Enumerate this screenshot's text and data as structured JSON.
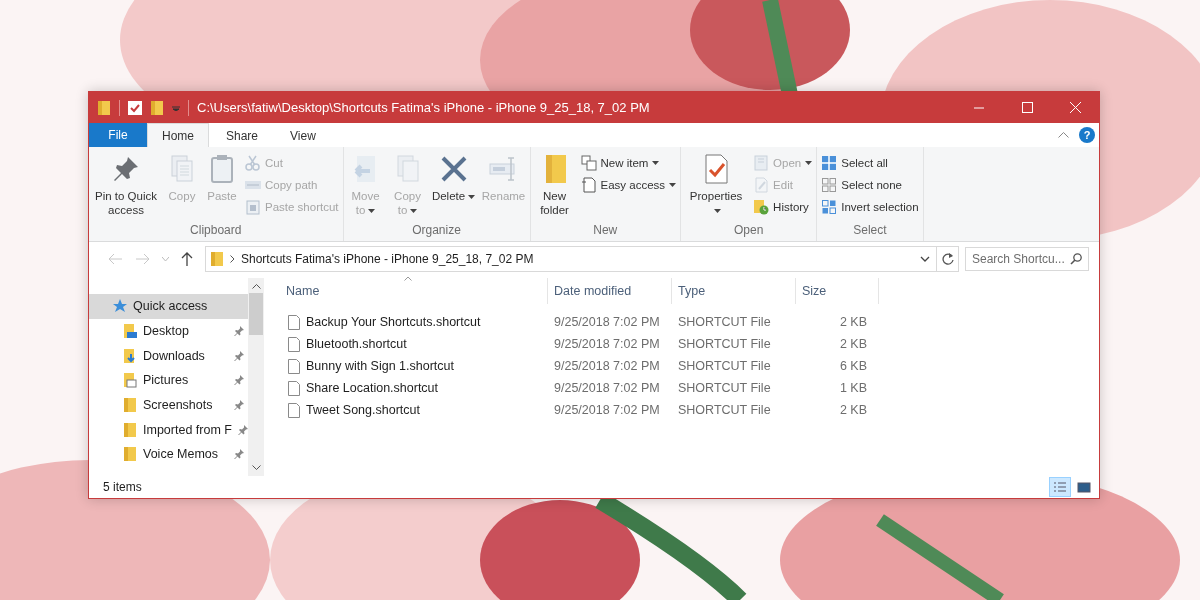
{
  "window": {
    "title": "C:\\Users\\fatiw\\Desktop\\Shortcuts Fatima's iPhone - iPhone 9_25_18, 7_02 PM"
  },
  "tabs": [
    {
      "label": "File",
      "kind": "file",
      "selected": false
    },
    {
      "label": "Home",
      "kind": "tab",
      "selected": true
    },
    {
      "label": "Share",
      "kind": "tab",
      "selected": false
    },
    {
      "label": "View",
      "kind": "tab",
      "selected": false
    }
  ],
  "help_button": "?",
  "ribbon": {
    "groups": [
      {
        "label": "Clipboard",
        "items": [
          {
            "label": "Pin to Quick access",
            "kind": "large",
            "disabled": false,
            "dropdown": false
          },
          {
            "label": "Copy",
            "kind": "large",
            "disabled": true,
            "dropdown": false
          },
          {
            "label": "Paste",
            "kind": "large",
            "disabled": true,
            "dropdown": false
          },
          {
            "label": "Cut",
            "kind": "small",
            "disabled": true,
            "dropdown": false
          },
          {
            "label": "Copy path",
            "kind": "small",
            "disabled": true,
            "dropdown": false
          },
          {
            "label": "Paste shortcut",
            "kind": "small",
            "disabled": true,
            "dropdown": false
          }
        ]
      },
      {
        "label": "Organize",
        "items": [
          {
            "label": "Move to",
            "kind": "large",
            "disabled": true,
            "dropdown": true
          },
          {
            "label": "Copy to",
            "kind": "large",
            "disabled": true,
            "dropdown": true
          },
          {
            "label": "Delete",
            "kind": "large",
            "disabled": false,
            "dropdown": true
          },
          {
            "label": "Rename",
            "kind": "large",
            "disabled": true,
            "dropdown": false
          }
        ]
      },
      {
        "label": "New",
        "items": [
          {
            "label": "New folder",
            "kind": "large",
            "disabled": false,
            "dropdown": false
          },
          {
            "label": "New item",
            "kind": "small",
            "disabled": false,
            "dropdown": true
          },
          {
            "label": "Easy access",
            "kind": "small",
            "disabled": false,
            "dropdown": true
          }
        ]
      },
      {
        "label": "Open",
        "items": [
          {
            "label": "Properties",
            "kind": "large",
            "disabled": false,
            "dropdown": true
          },
          {
            "label": "Open",
            "kind": "small",
            "disabled": true,
            "dropdown": true
          },
          {
            "label": "Edit",
            "kind": "small",
            "disabled": true,
            "dropdown": false
          },
          {
            "label": "History",
            "kind": "small",
            "disabled": false,
            "dropdown": false
          }
        ]
      },
      {
        "label": "Select",
        "items": [
          {
            "label": "Select all",
            "kind": "small",
            "disabled": false,
            "dropdown": false
          },
          {
            "label": "Select none",
            "kind": "small",
            "disabled": false,
            "dropdown": false
          },
          {
            "label": "Invert selection",
            "kind": "small",
            "disabled": false,
            "dropdown": false
          }
        ]
      }
    ]
  },
  "navigation": {
    "back_disabled": true,
    "forward_disabled": true
  },
  "address_bar": {
    "path": "Shortcuts Fatima's iPhone - iPhone 9_25_18, 7_02 PM"
  },
  "search": {
    "placeholder": "Search Shortcu..."
  },
  "sidebar": {
    "items": [
      {
        "label": "Quick access",
        "kind": "root",
        "selected": true,
        "pinned": false
      },
      {
        "label": "Desktop",
        "kind": "folder",
        "selected": false,
        "pinned": true
      },
      {
        "label": "Downloads",
        "kind": "folder",
        "selected": false,
        "pinned": true
      },
      {
        "label": "Pictures",
        "kind": "folder",
        "selected": false,
        "pinned": true
      },
      {
        "label": "Screenshots",
        "kind": "folder",
        "selected": false,
        "pinned": true
      },
      {
        "label": "Imported from F",
        "kind": "folder",
        "selected": false,
        "pinned": true
      },
      {
        "label": "Voice Memos",
        "kind": "folder",
        "selected": false,
        "pinned": true
      }
    ]
  },
  "table": {
    "columns": [
      "Name",
      "Date modified",
      "Type",
      "Size"
    ],
    "rows": [
      {
        "name": "Backup Your Shortcuts.shortcut",
        "date": "9/25/2018 7:02 PM",
        "type": "SHORTCUT File",
        "size": "2 KB"
      },
      {
        "name": "Bluetooth.shortcut",
        "date": "9/25/2018 7:02 PM",
        "type": "SHORTCUT File",
        "size": "2 KB"
      },
      {
        "name": "Bunny with Sign 1.shortcut",
        "date": "9/25/2018 7:02 PM",
        "type": "SHORTCUT File",
        "size": "6 KB"
      },
      {
        "name": "Share Location.shortcut",
        "date": "9/25/2018 7:02 PM",
        "type": "SHORTCUT File",
        "size": "1 KB"
      },
      {
        "name": "Tweet Song.shortcut",
        "date": "9/25/2018 7:02 PM",
        "type": "SHORTCUT File",
        "size": "2 KB"
      }
    ]
  },
  "status_bar": {
    "text": "5 items"
  },
  "view_buttons": [
    {
      "selected": true
    },
    {
      "selected": false
    }
  ]
}
